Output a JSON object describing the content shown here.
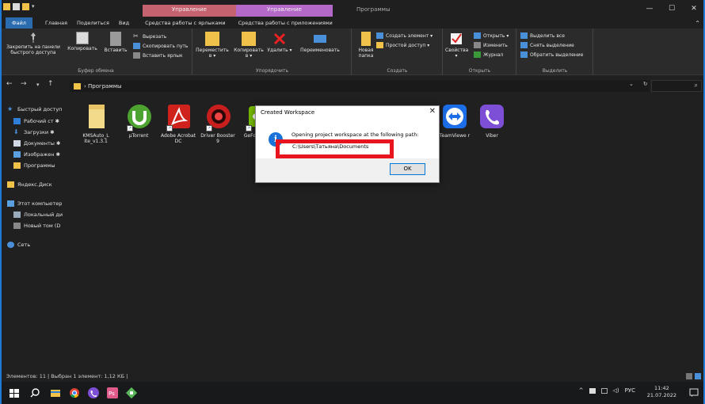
{
  "window": {
    "context_tabs": [
      "Управление",
      "Управление",
      "Программы"
    ],
    "controls": [
      "—",
      "☐",
      "✕"
    ]
  },
  "tabs": [
    "Файл",
    "Главная",
    "Поделиться",
    "Вид",
    "Средства работы с ярлыками",
    "Средства работы с приложениями"
  ],
  "ribbon": {
    "clipboard": {
      "pin": "Закрепить на панели быстрого доступа",
      "copy": "Копировать",
      "paste": "Вставить",
      "cut": "Вырезать",
      "copy_path": "Скопировать путь",
      "paste_shortcut": "Вставить ярлык",
      "label": "Буфер обмена"
    },
    "organize": {
      "move": "Переместить в ▾",
      "copy_to": "Копировать в ▾",
      "delete": "Удалить ▾",
      "rename": "Переименовать",
      "label": "Упорядочить"
    },
    "create": {
      "new_folder": "Новая папка",
      "new_item": "Создать элемент ▾",
      "easy_access": "Простой доступ ▾",
      "label": "Создать"
    },
    "open": {
      "properties": "Свойства ▾",
      "open": "Открыть ▾",
      "edit": "Изменить",
      "history": "Журнал",
      "label": "Открыть"
    },
    "select": {
      "select_all": "Выделить все",
      "select_none": "Снять выделение",
      "invert": "Обратить выделение",
      "label": "Выделить"
    }
  },
  "address": {
    "path": "› Программы",
    "back": "←",
    "forward": "→",
    "recent": "▾",
    "up": "↑",
    "dropdown": "⌄",
    "refresh": "↻",
    "search_icon": "⌕"
  },
  "nav": {
    "items": [
      {
        "label": "Быстрый доступ"
      },
      {
        "label": "Рабочий ст ✱"
      },
      {
        "label": "Загрузки ✱"
      },
      {
        "label": "Документы ✱"
      },
      {
        "label": "Изображен ✱"
      },
      {
        "label": "Программы"
      },
      {
        "label": "Яндекс.Диск"
      },
      {
        "label": "Этот компьютер"
      },
      {
        "label": "Локальный ди"
      },
      {
        "label": "Новый том (D"
      },
      {
        "label": "Сеть"
      }
    ]
  },
  "files": [
    {
      "label": "KMSAuto_L ite_v1.3.1",
      "color": "#f3d98a"
    },
    {
      "label": "µTorrent",
      "color": "#4ca32f"
    },
    {
      "label": "Adobe Acrobat DC",
      "color": "#d0221c"
    },
    {
      "label": "Driver Booster 9",
      "color": "#c81e1e"
    },
    {
      "label": "GeFo Exper",
      "color": "#76b900"
    },
    {
      "label": "TeamViewe r",
      "color": "#1c6ee8"
    },
    {
      "label": "Viber",
      "color": "#7d4fd6"
    }
  ],
  "dialog": {
    "title": "Created Workspace",
    "close": "✕",
    "message": "Opening project workspace at the following path:",
    "path": "C:\\Users\\Татьяна\\Documents",
    "ok": "OK",
    "info": "i"
  },
  "status": {
    "text": "Элементов: 11  |  Выбран 1 элемент: 1,12 КБ  |"
  },
  "taskbar": {
    "tray": [
      "^",
      "📶",
      "🔊",
      "РУС"
    ],
    "time": "11:42",
    "date": "21.07.2022"
  },
  "colors": {
    "accent": "#1f7ad6",
    "context_shortcut": "#c4626f",
    "context_app": "#b468c7",
    "highlight": "#e8141e"
  }
}
